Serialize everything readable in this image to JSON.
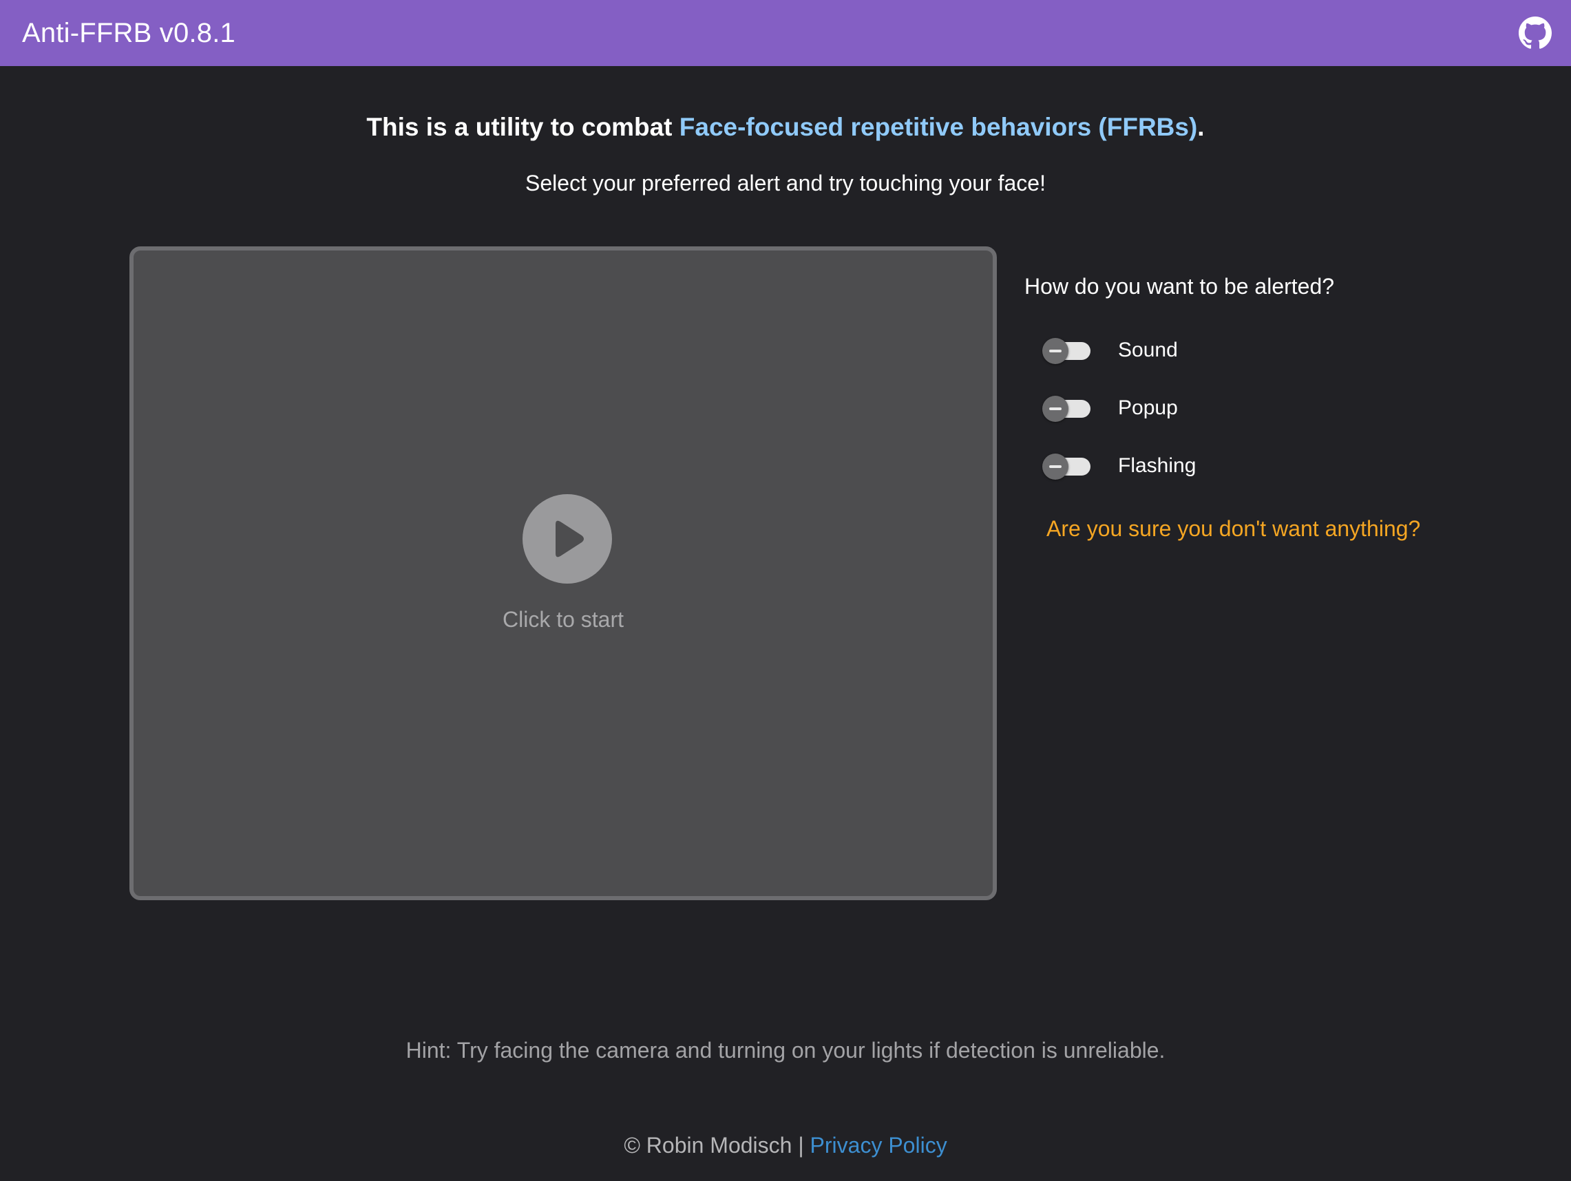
{
  "app": {
    "title": "Anti-FFRB v0.8.1",
    "github_icon": "github-icon",
    "bar_color": "#845fc4"
  },
  "intro": {
    "prefix": "This is a utility to combat ",
    "link_text": "Face-focused repetitive behaviors (FFRBs)",
    "suffix": ".",
    "instruction": "Select your preferred alert and try touching your face!"
  },
  "video": {
    "start_label": "Click to start",
    "play_icon": "play-icon"
  },
  "alerts": {
    "title": "How do you want to be alerted?",
    "options": [
      {
        "label": "Sound",
        "enabled": false
      },
      {
        "label": "Popup",
        "enabled": false
      },
      {
        "label": "Flashing",
        "enabled": false
      }
    ],
    "warning": "Are you sure you don't want anything?",
    "warning_color": "#f5a623"
  },
  "hint": "Hint: Try facing the camera and turning on your lights if detection is unreliable.",
  "footer": {
    "copyright": "© Robin Modisch | ",
    "privacy_link": "Privacy Policy"
  }
}
